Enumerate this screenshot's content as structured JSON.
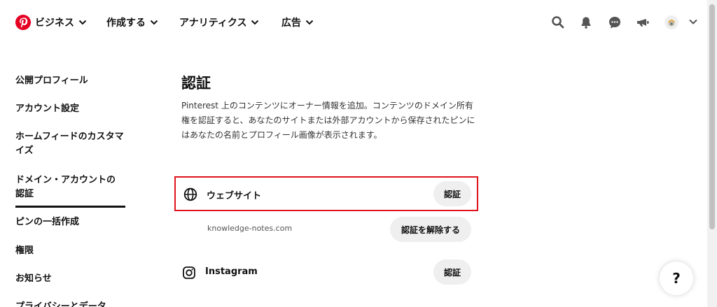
{
  "nav": {
    "business": "ビジネス",
    "create": "作成する",
    "analytics": "アナリティクス",
    "ads": "広告",
    "icons": [
      "search-icon",
      "bell-icon",
      "chat-icon",
      "megaphone-icon",
      "avatar",
      "chevron-down-icon"
    ]
  },
  "sidebar": {
    "items": [
      {
        "label": "公開プロフィール"
      },
      {
        "label": "アカウント設定"
      },
      {
        "label": "ホームフィードのカスタマイズ"
      },
      {
        "label": "ドメイン・アカウントの認証",
        "active": true
      },
      {
        "label": "ピンの一括作成"
      },
      {
        "label": "権限"
      },
      {
        "label": "お知らせ"
      },
      {
        "label": "プライバシーとデータ"
      }
    ]
  },
  "main": {
    "title": "認証",
    "description": "Pinterest 上のコンテンツにオーナー情報を追加。コンテンツのドメイン所有権を認証すると、あなたのサイトまたは外部アカウントから保存されたピンにはあなたの名前とプロフィール画像が表示されます。",
    "rows": [
      {
        "label": "ウェブサイト",
        "action": "認証",
        "icon": "globe-icon",
        "highlighted": true
      },
      {
        "domain": "knowledge-notes.com",
        "action": "認証を解除する"
      },
      {
        "label": "Instagram",
        "action": "認証",
        "icon": "instagram-icon"
      }
    ]
  },
  "help": {
    "label": "?"
  },
  "colors": {
    "brand": "#e60023",
    "highlight": "#e0141e",
    "pill_bg": "#efefef"
  }
}
